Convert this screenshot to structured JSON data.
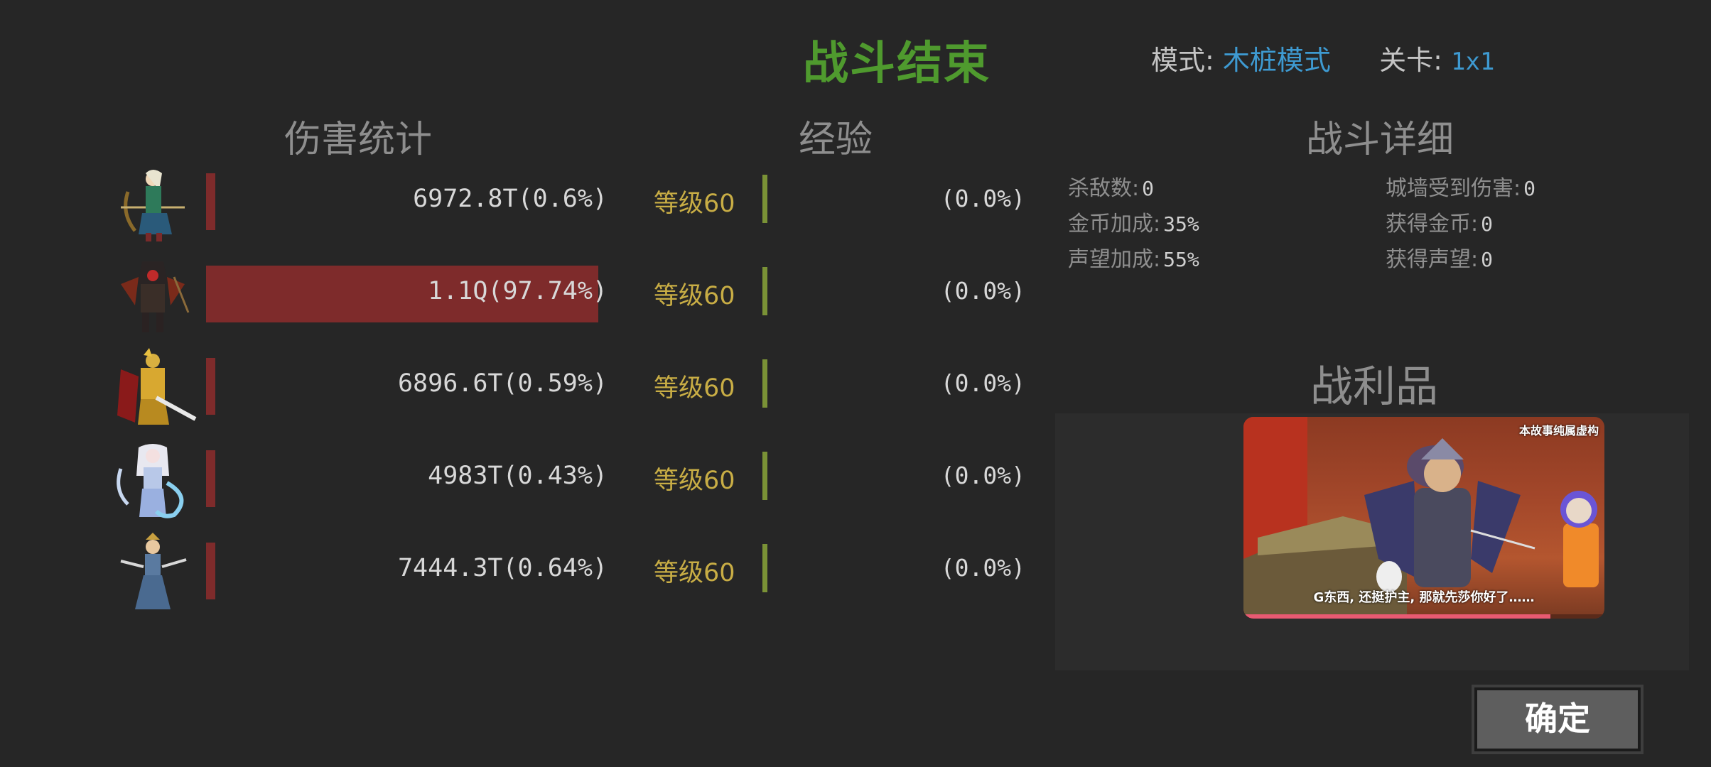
{
  "header": {
    "title": "战斗结束",
    "mode_label": "模式:",
    "mode_value": "木桩模式",
    "stage_label": "关卡:",
    "stage_value": "1x1"
  },
  "sections": {
    "damage": "伤害统计",
    "exp": "经验",
    "details": "战斗详细",
    "loot": "战利品"
  },
  "heroes": [
    {
      "portrait": "elf-archer",
      "damage": "6972.8T(0.6%)",
      "damage_share": 0.006,
      "level": "等级60",
      "exp": "(0.0%)",
      "exp_share": 0.0
    },
    {
      "portrait": "hooded-assassin",
      "damage": "1.1Q(97.74%)",
      "damage_share": 0.9774,
      "level": "等级60",
      "exp": "(0.0%)",
      "exp_share": 0.0
    },
    {
      "portrait": "golden-knight",
      "damage": "6896.6T(0.59%)",
      "damage_share": 0.0059,
      "level": "等级60",
      "exp": "(0.0%)",
      "exp_share": 0.0
    },
    {
      "portrait": "ice-sorceress",
      "damage": "4983T(0.43%)",
      "damage_share": 0.0043,
      "level": "等级60",
      "exp": "(0.0%)",
      "exp_share": 0.0
    },
    {
      "portrait": "blade-dancer",
      "damage": "7444.3T(0.64%)",
      "damage_share": 0.0064,
      "level": "等级60",
      "exp": "(0.0%)",
      "exp_share": 0.0
    }
  ],
  "details": {
    "kills_label": "杀敌数:",
    "kills": "0",
    "gold_bonus_label": "金币加成:",
    "gold_bonus": "35%",
    "fame_bonus_label": "声望加成:",
    "fame_bonus": "55%",
    "wall_damage_label": "城墙受到伤害:",
    "wall_damage": "0",
    "gold_gained_label": "获得金币:",
    "gold_gained": "0",
    "fame_gained_label": "获得声望:",
    "fame_gained": "0"
  },
  "ad": {
    "tag": "本故事纯属虚构",
    "subtitle": "G东西, 还挺护主, 那就先莎你好了……",
    "progress": 0.85
  },
  "confirm_button": "确定",
  "colors": {
    "title": "#4f9a2e",
    "damage_bar": "#7e2b2b",
    "exp_bar": "#7a9236",
    "level_text": "#c8ad45",
    "mode_value": "#3e9ad1"
  }
}
